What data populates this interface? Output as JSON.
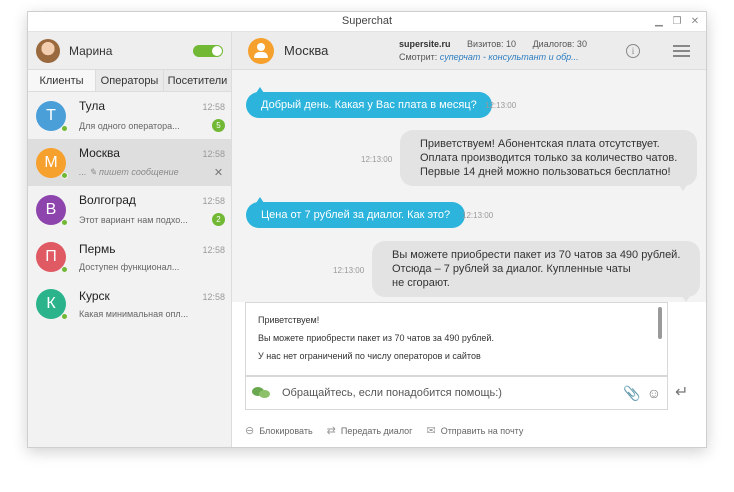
{
  "window": {
    "title": "Superchat"
  },
  "user": {
    "name": "Марина"
  },
  "tabs": [
    "Клиенты",
    "Операторы",
    "Посетители"
  ],
  "contacts": [
    {
      "initial": "Т",
      "name": "Тула",
      "time": "12:58",
      "preview": "Для одного оператора...",
      "badge": "5",
      "color": "#4a9fd8"
    },
    {
      "initial": "М",
      "name": "Москва",
      "time": "12:58",
      "preview": "... ✎ пишет сообщение",
      "close": "✕",
      "color": "#f6a02d"
    },
    {
      "initial": "В",
      "name": "Волгоград",
      "time": "12:58",
      "preview": "Этот вариант нам подхо...",
      "badge": "2",
      "color": "#8e44ad"
    },
    {
      "initial": "П",
      "name": "Пермь",
      "time": "12:58",
      "preview": "Доступен функционал...",
      "color": "#e05a64"
    },
    {
      "initial": "К",
      "name": "Курск",
      "time": "12:58",
      "preview": "Какая минимальная опл...",
      "color": "#2bb48c"
    }
  ],
  "header": {
    "name": "Москва",
    "site": "supersite.ru",
    "visits": "Визитов: 10",
    "dialogs": "Диалогов: 30",
    "viewing_label": "Смотрит:",
    "viewing_link": "суперчат - консультант и обр..."
  },
  "messages": [
    {
      "text": "Добрый день. Какая у Вас плата в месяц?",
      "time": "12:13:00"
    },
    {
      "text": "Приветствуем! Абонентская плата отсутствует.\nОплата производится только за количество чатов.\nПервые 14 дней можно пользоваться бесплатно!",
      "time": "12:13:00"
    },
    {
      "text": "Цена от 7 рублей за диалог. Как это?",
      "time": "12:13:00"
    },
    {
      "text": "Вы можете приобрести пакет из 70 чатов за 490 рублей.\nОтсюда – 7 рублей за диалог. Купленные чаты\nне сгорают.",
      "time": "12:13:00"
    }
  ],
  "quick_replies": [
    "Приветствуем!",
    "Вы можете приобрести пакет из 70 чатов за 490 рублей.",
    "У нас нет ограничений по числу операторов и сайтов"
  ],
  "composer": {
    "placeholder": "Обращайтесь, если понадобится помощь:)"
  },
  "actions": {
    "block": "Блокировать",
    "transfer": "Передать диалог",
    "email": "Отправить на почту"
  }
}
